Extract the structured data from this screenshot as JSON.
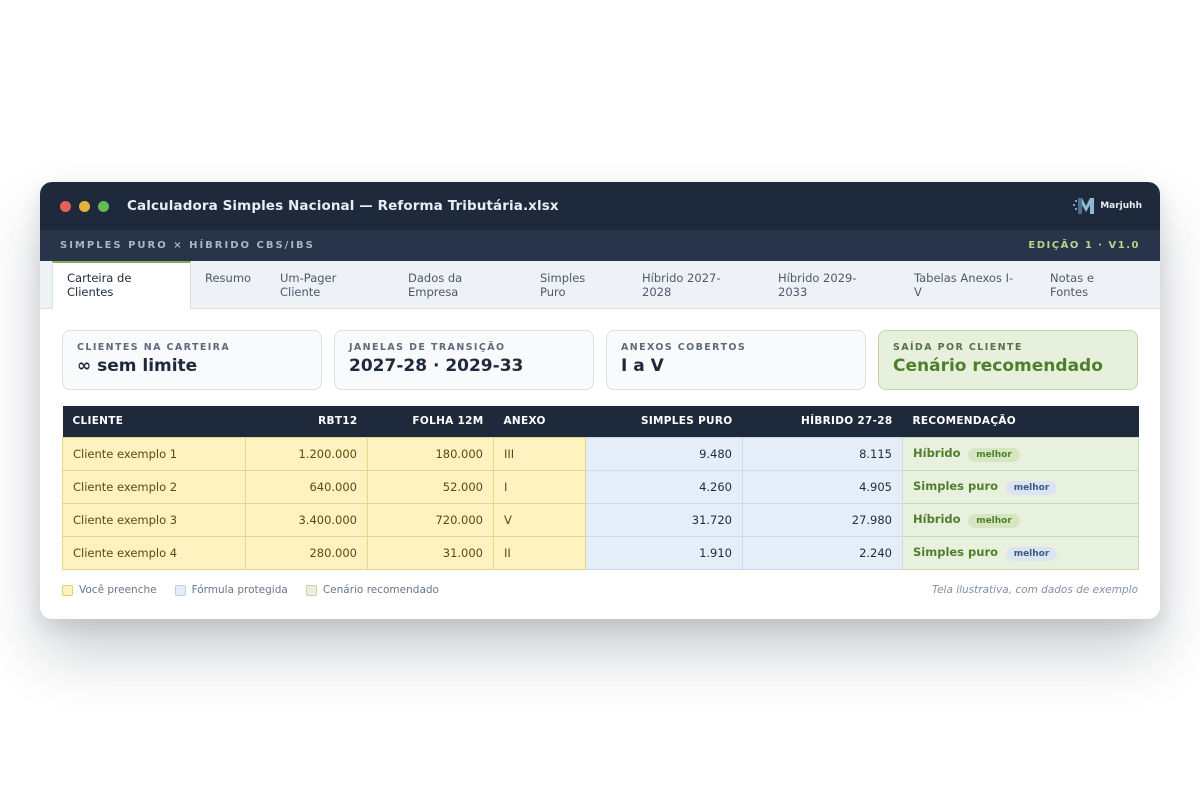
{
  "window": {
    "title": "Calculadora Simples Nacional — Reforma Tributária.xlsx",
    "brand": "Marjuhh"
  },
  "subbar": {
    "left": "SIMPLES PURO  ×  HÍBRIDO CBS/IBS",
    "right": "EDIÇÃO 1 · V1.0"
  },
  "tabs": [
    {
      "line1": "Carteira de",
      "line2": "Clientes",
      "active": true
    },
    {
      "line1": "Resumo",
      "line2": ""
    },
    {
      "line1": "Um-Pager",
      "line2": "Cliente"
    },
    {
      "line1": "Dados da",
      "line2": "Empresa"
    },
    {
      "line1": "Simples",
      "line2": "Puro"
    },
    {
      "line1": "Híbrido 2027-",
      "line2": "2028"
    },
    {
      "line1": "Híbrido 2029-",
      "line2": "2033"
    },
    {
      "line1": "Tabelas Anexos I-",
      "line2": "V"
    },
    {
      "line1": "Notas e",
      "line2": "Fontes"
    }
  ],
  "cards": [
    {
      "label": "CLIENTES NA CARTEIRA",
      "value": "∞ sem limite"
    },
    {
      "label": "JANELAS DE TRANSIÇÃO",
      "value": "2027-28 · 2029-33"
    },
    {
      "label": "ANEXOS COBERTOS",
      "value": "I a V"
    },
    {
      "label": "SAÍDA POR CLIENTE",
      "value": "Cenário recomendado"
    }
  ],
  "table": {
    "headers": [
      "CLIENTE",
      "RBT12",
      "FOLHA 12M",
      "ANEXO",
      "SIMPLES PURO",
      "HÍBRIDO 27-28",
      "RECOMENDAÇÃO"
    ],
    "rows": [
      {
        "cliente": "Cliente exemplo 1",
        "rbt12": "1.200.000",
        "folha": "180.000",
        "anexo": "III",
        "simples": "9.480",
        "hibrido": "8.115",
        "rec": "Híbrido",
        "badge": "melhor"
      },
      {
        "cliente": "Cliente exemplo 2",
        "rbt12": "640.000",
        "folha": "52.000",
        "anexo": "I",
        "simples": "4.260",
        "hibrido": "4.905",
        "rec": "Simples puro",
        "badge": "melhor"
      },
      {
        "cliente": "Cliente exemplo 3",
        "rbt12": "3.400.000",
        "folha": "720.000",
        "anexo": "V",
        "simples": "31.720",
        "hibrido": "27.980",
        "rec": "Híbrido",
        "badge": "melhor"
      },
      {
        "cliente": "Cliente exemplo 4",
        "rbt12": "280.000",
        "folha": "31.000",
        "anexo": "II",
        "simples": "1.910",
        "hibrido": "2.240",
        "rec": "Simples puro",
        "badge": "melhor"
      }
    ]
  },
  "legend": {
    "yellow": "Você preenche",
    "blue": "Fórmula protegida",
    "green": "Cenário recomendado"
  },
  "note": "Tela ilustrativa, com dados de exemplo",
  "colors": {
    "titlebar": "#1e2a3c",
    "accent_green": "#4e7f2b",
    "input_yellow": "#fdf2c0",
    "formula_blue": "#e5eef8"
  }
}
